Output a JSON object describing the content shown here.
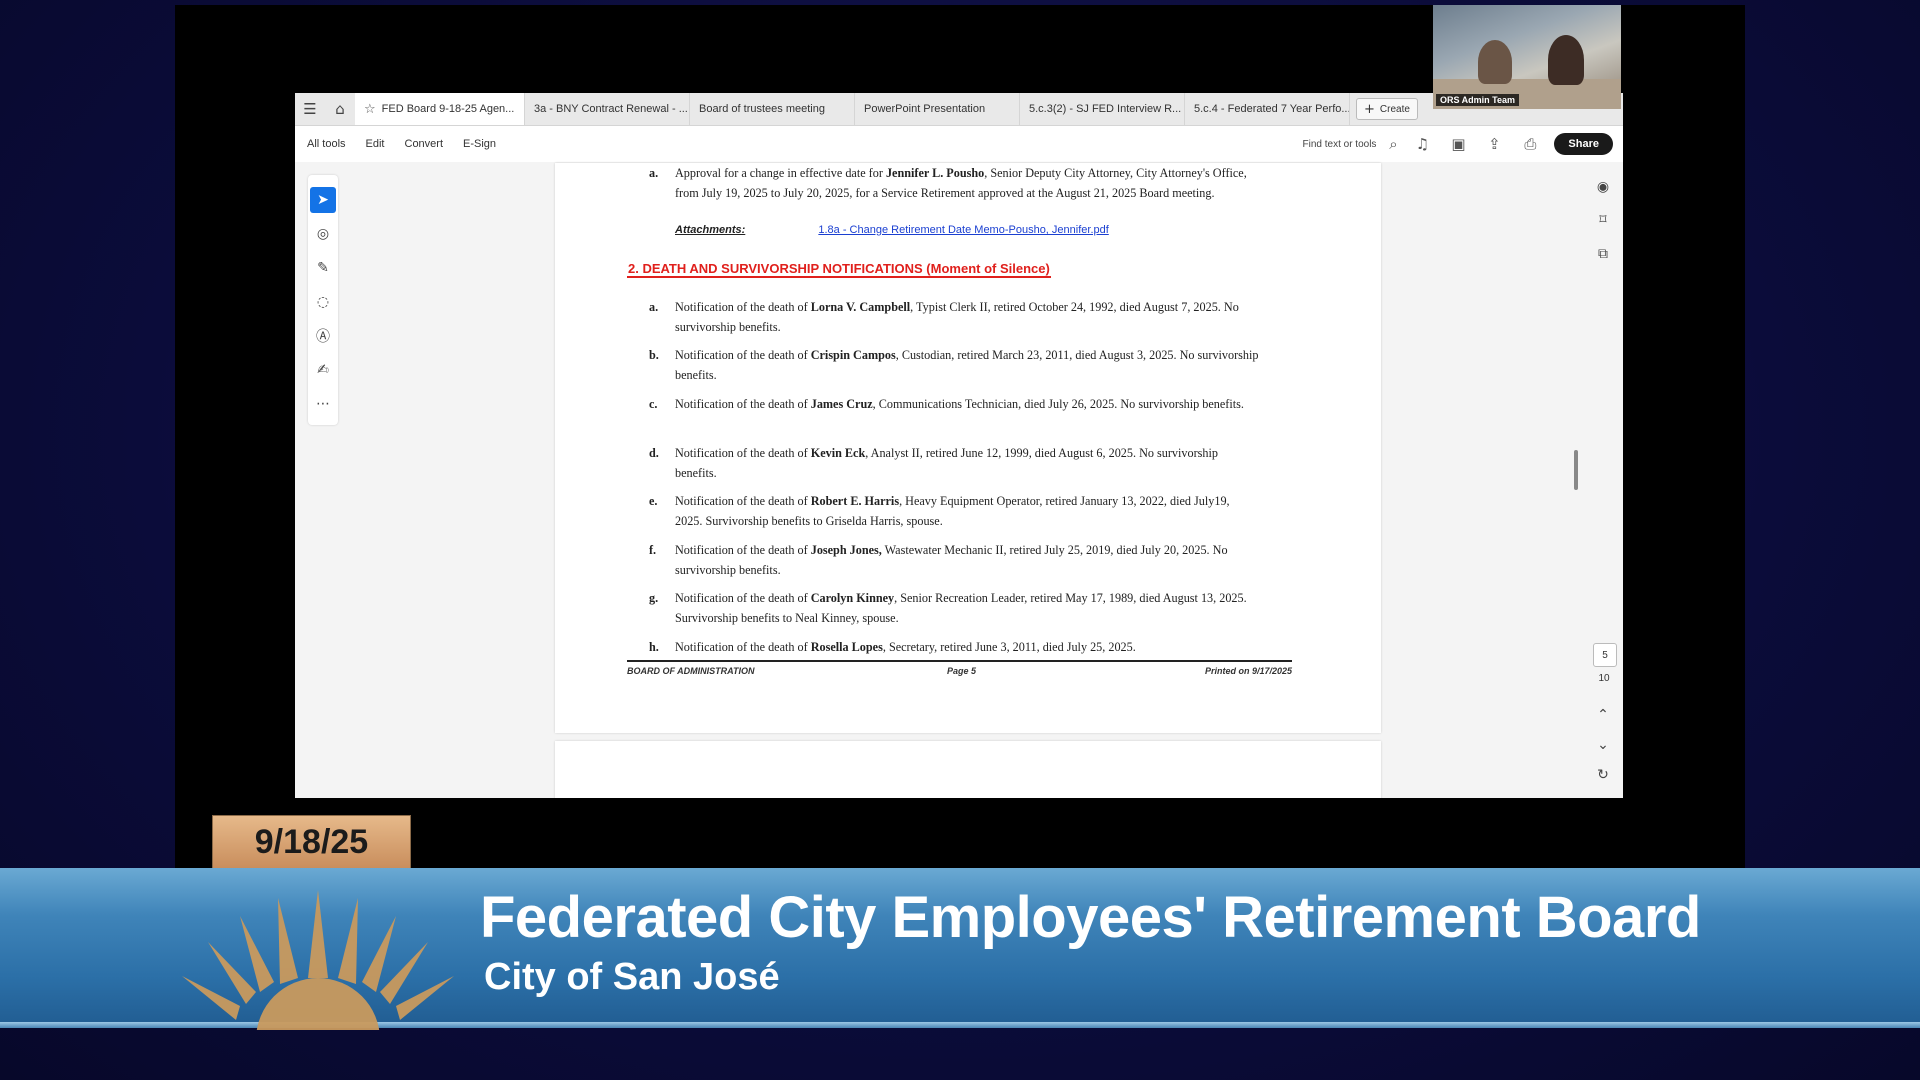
{
  "tabs": [
    {
      "label": "FED Board 9-18-25 Agen..."
    },
    {
      "label": "3a - BNY Contract Renewal - ..."
    },
    {
      "label": "Board of trustees meeting"
    },
    {
      "label": "PowerPoint Presentation"
    },
    {
      "label": "5.c.3(2) - SJ FED Interview R..."
    },
    {
      "label": "5.c.4 - Federated 7 Year Perfo..."
    }
  ],
  "create_label": "Create",
  "menu": [
    "All tools",
    "Edit",
    "Convert",
    "E-Sign"
  ],
  "find_placeholder": "Find text or tools",
  "share_label": "Share",
  "doc": {
    "item_a_top": {
      "label": "a.",
      "pre": "Approval for a change in effective date for ",
      "name": "Jennifer L. Pousho",
      "post": ", Senior Deputy City Attorney, City Attorney's Office, from July 19, 2025 to July 20, 2025, for a Service Retirement approved at the August 21, 2025 Board meeting."
    },
    "attachments_label": "Attachments:",
    "attachment_link": "1.8a - Change Retirement Date Memo-Pousho, Jennifer.pdf",
    "section_title": "2.  DEATH AND SURVIVORSHIP NOTIFICATIONS (Moment of Silence)",
    "items": [
      {
        "label": "a.",
        "pre": "Notification of the death of ",
        "name": "Lorna V. Campbell",
        "post": ", Typist Clerk II, retired October 24, 1992, died August 7, 2025. No survivorship benefits."
      },
      {
        "label": "b.",
        "pre": "Notification of the death of ",
        "name": "Crispin Campos",
        "post": ", Custodian, retired March 23, 2011, died August 3, 2025. No survivorship benefits."
      },
      {
        "label": "c.",
        "pre": "Notification of the death of ",
        "name": "James Cruz",
        "post": ", Communications Technician, died July 26, 2025. No survivorship benefits."
      },
      {
        "label": "d.",
        "pre": "Notification of the death of ",
        "name": "Kevin Eck",
        "post": ", Analyst II, retired June 12, 1999, died August 6, 2025. No survivorship benefits."
      },
      {
        "label": "e.",
        "pre": "Notification of the death of ",
        "name": "Robert E. Harris",
        "post": ", Heavy Equipment Operator, retired January 13, 2022, died July19, 2025. Survivorship benefits to Griselda Harris, spouse."
      },
      {
        "label": "f.",
        "pre": "Notification of the death of ",
        "name": "Joseph Jones,",
        "post": " Wastewater Mechanic II, retired July 25, 2019, died July 20, 2025. No survivorship benefits."
      },
      {
        "label": "g.",
        "pre": "Notification of the death of ",
        "name": "Carolyn Kinney",
        "post": ", Senior Recreation Leader, retired May 17, 1989, died August 13, 2025. Survivorship benefits to Neal Kinney, spouse."
      },
      {
        "label": "h.",
        "pre": "Notification of the death of ",
        "name": "Rosella Lopes",
        "post": ", Secretary, retired June 3, 2011, died July 25, 2025."
      }
    ],
    "footer_left": "BOARD OF ADMINISTRATION",
    "footer_center": "Page 5",
    "footer_right": "Printed on 9/17/2025"
  },
  "page_current": "5",
  "page_total": "10",
  "webcam_label": "ORS Admin Team",
  "broadcast": {
    "date": "9/18/25",
    "title": "Federated City Employees' Retirement Board",
    "subtitle": "City of San José"
  }
}
